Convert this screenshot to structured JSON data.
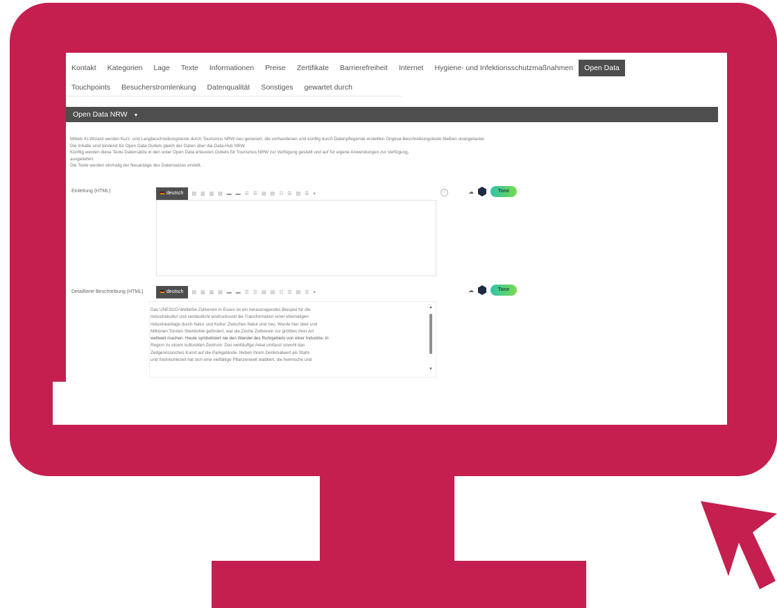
{
  "tabs": {
    "row1": [
      "Kontakt",
      "Kategorien",
      "Lage",
      "Texte",
      "Informationen",
      "Preise",
      "Zertifikate",
      "Barrierefreiheit",
      "Internet",
      "Hygiene- und Infektionsschutzmaßnahmen",
      "Open Data"
    ],
    "row2": [
      "Touchpoints",
      "Besucherstromlenkung",
      "Datenqualität",
      "Sonstiges",
      "gewartet durch"
    ],
    "active": "Open Data"
  },
  "panel": {
    "title": "Open Data NRW",
    "caret": "▼"
  },
  "info_lines": [
    "Mittels KI-Wizard werden Kurz- und Langbeschreibungstexte durch Tourismus NRW neu generiert, die vorhandenen und künftig durch Datenpflegende erstellten Original-Beschreibungstexte bleiben unangetastet.",
    "Die Inhalte sind bindend für Open Data Outlets gleich der Daten über die Data-Hub NRW.",
    "Künftig werden diese Texte Datensätze in den unter Open Data erfassten Outlets für Tourismus NRW zur Verfügung gestellt und auf für eigene Anwendungen zur Verfügung,",
    "ausgeliefert.",
    "Die Texte werden einmalig bei Neuanlage des Datensatzes erstellt."
  ],
  "fields": [
    {
      "label": "Einleitung (HTML)",
      "lang": "deutsch",
      "text": []
    },
    {
      "label": "Detaillierte Beschreibung (HTML)",
      "lang": "deutsch",
      "text": [
        "Das UNESCO-Welterbe Zollverein in Essen ist ein herausragendes Beispiel für die",
        "Industriekultur und verdeutlicht eindrucksvoll die Transformation einer ehemaligen",
        "Industrieanlage durch Natur und Kultur. Zwischen Natur und neu. Wurde hier über und",
        "Millionen Tonnen Steinkohle gefördert, war die Zeche Zollverein zur größten ihrer Art",
        "weltweit machen. Heute symbolisiert sie den Wandel des Ruhrgebiets von einer Industrie- in",
        "Region zu einem kulturellen Zentrum. Das weitläufige Areal umfasst sowohl das",
        "Zeitgenössisches Kunst auf die Parkgelände. Neben ihrem Denkmalwert als Stahl-",
        "und Steinkohlezeit hat sich eine vielfältige Pflanzenwelt etabliert, die heimische und"
      ]
    }
  ],
  "toolbar_icons": "▤ ▥ ▥ ▤ ▬ ▬ ☰ ☰ ▤ ▤ ☷ ☰ ▤ ☰ ▾",
  "side_icons": {
    "cloud": "☁︎",
    "ai_button": "Tone"
  },
  "info_icon": "i",
  "scroll": {
    "up": "▲",
    "down": "▼"
  },
  "colors": {
    "frame": "#c41f4f",
    "panel": "#4e4e4e",
    "ai_start": "#2ec4a8",
    "ai_end": "#7ad94f"
  }
}
